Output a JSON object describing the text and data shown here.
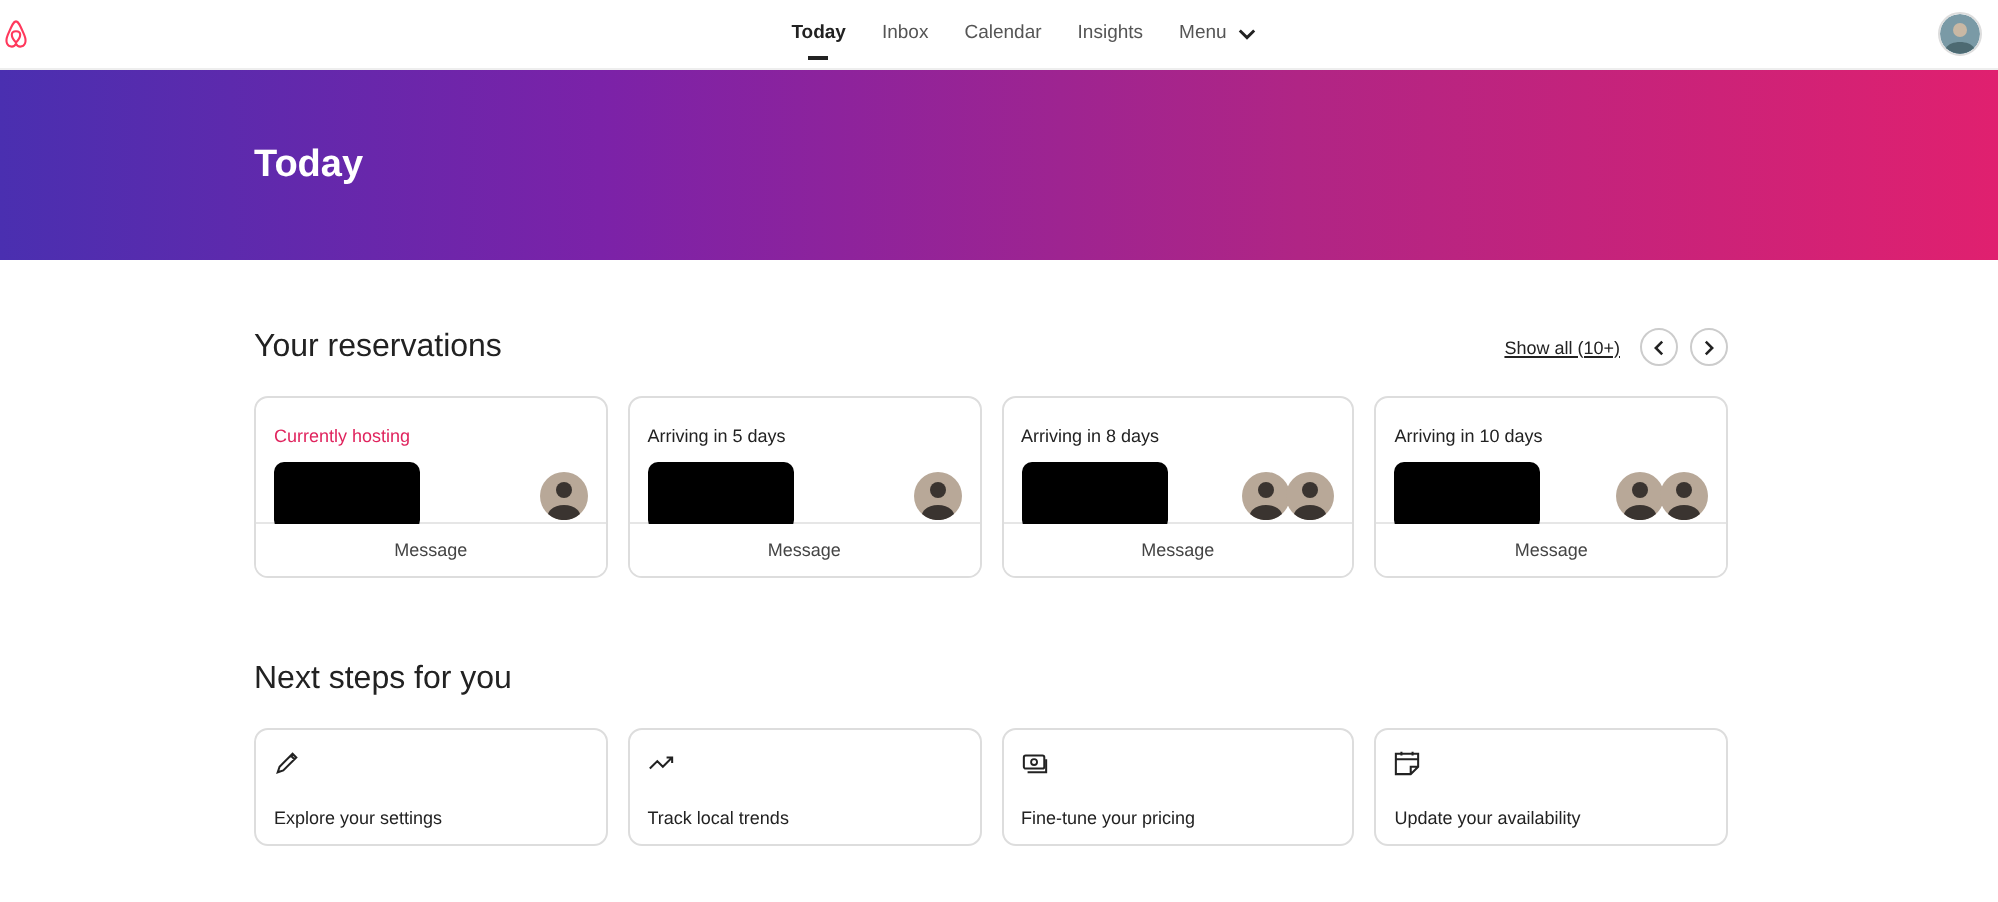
{
  "nav": {
    "tabs": [
      {
        "label": "Today",
        "selected": true
      },
      {
        "label": "Inbox",
        "selected": false
      },
      {
        "label": "Calendar",
        "selected": false
      },
      {
        "label": "Insights",
        "selected": false
      },
      {
        "label": "Menu",
        "selected": false,
        "kind": "dropdown"
      }
    ]
  },
  "banner": {
    "title": "Today"
  },
  "reservations": {
    "title": "Your reservations",
    "show_all": "Show all (10+)",
    "cards": [
      {
        "status": "Currently hosting",
        "highlight": true,
        "guests": [
          {
            "kind": "avatar"
          }
        ],
        "action": "Message"
      },
      {
        "status": "Arriving in 5 days",
        "highlight": false,
        "guests": [
          {
            "kind": "avatar"
          }
        ],
        "action": "Message"
      },
      {
        "status": "Arriving in 8 days",
        "highlight": false,
        "guests": [
          {
            "kind": "avatar"
          },
          {
            "kind": "avatar"
          }
        ],
        "action": "Message"
      },
      {
        "status": "Arriving in 10 days",
        "highlight": false,
        "guests": [
          {
            "kind": "avatar"
          },
          {
            "kind": "avatar"
          }
        ],
        "action": "Message"
      }
    ]
  },
  "next_steps": {
    "title": "Next steps for you",
    "items": [
      {
        "kind": "pencil",
        "label": "Explore your settings"
      },
      {
        "kind": "trend",
        "label": "Track local trends"
      },
      {
        "kind": "money",
        "label": "Fine-tune your pricing"
      },
      {
        "kind": "calendar",
        "label": "Update your availability"
      }
    ]
  }
}
